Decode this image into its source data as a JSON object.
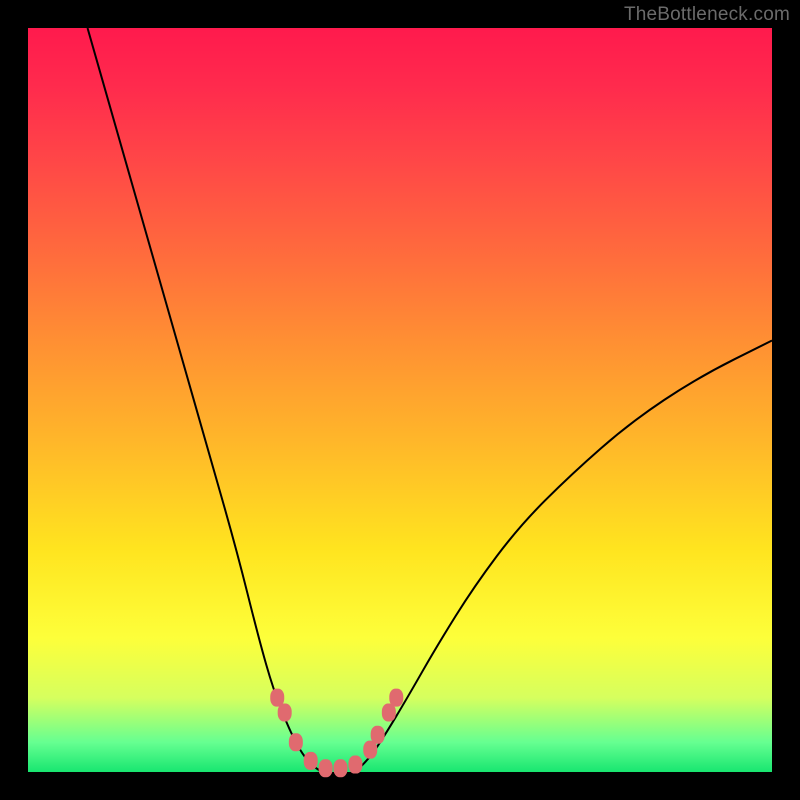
{
  "watermark": "TheBottleneck.com",
  "chart_data": {
    "type": "line",
    "title": "",
    "xlabel": "",
    "ylabel": "",
    "xlim": [
      0,
      100
    ],
    "ylim": [
      0,
      100
    ],
    "grid": false,
    "legend": false,
    "background_gradient": [
      "#ff1a4d",
      "#ff6a3d",
      "#ffe41f",
      "#18e670"
    ],
    "series": [
      {
        "name": "left-curve",
        "x": [
          8,
          12,
          16,
          20,
          24,
          28,
          31,
          33,
          35,
          36.5,
          38,
          39.5
        ],
        "y": [
          100,
          86,
          72,
          58,
          44,
          30,
          18,
          11,
          6,
          3,
          1,
          0
        ]
      },
      {
        "name": "right-curve",
        "x": [
          44,
          46,
          48,
          51,
          55,
          60,
          66,
          73,
          81,
          90,
          100
        ],
        "y": [
          0,
          2,
          5,
          10,
          17,
          25,
          33,
          40,
          47,
          53,
          58
        ]
      }
    ],
    "markers": {
      "name": "bottom-markers",
      "color": "#e06a6f",
      "points": [
        {
          "x": 33.5,
          "y": 10
        },
        {
          "x": 34.5,
          "y": 8
        },
        {
          "x": 36,
          "y": 4
        },
        {
          "x": 38,
          "y": 1.5
        },
        {
          "x": 40,
          "y": 0.5
        },
        {
          "x": 42,
          "y": 0.5
        },
        {
          "x": 44,
          "y": 1
        },
        {
          "x": 46,
          "y": 3
        },
        {
          "x": 47,
          "y": 5
        },
        {
          "x": 48.5,
          "y": 8
        },
        {
          "x": 49.5,
          "y": 10
        }
      ]
    }
  }
}
